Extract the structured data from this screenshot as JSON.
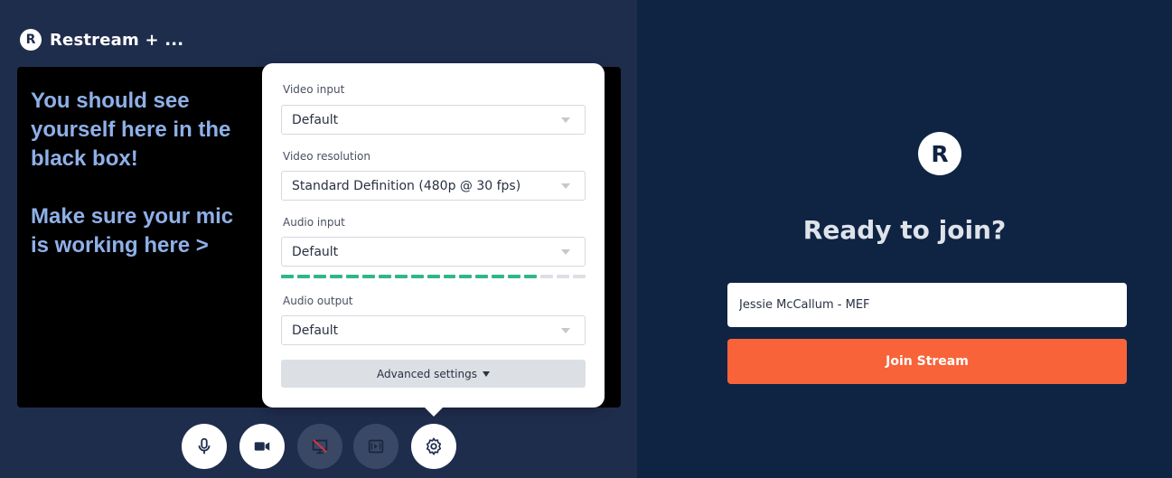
{
  "app": {
    "logo_letter": "R",
    "title": "Restream + ..."
  },
  "video_overlay": {
    "line1": "You should see yourself here in the black box!",
    "line2": "Make sure your mic is working here >"
  },
  "settings": {
    "video_input_label": "Video input",
    "video_input_value": "Default",
    "video_resolution_label": "Video resolution",
    "video_resolution_value": "Standard Definition (480p @ 30 fps)",
    "audio_input_label": "Audio input",
    "audio_input_value": "Default",
    "audio_level": {
      "active_segments": 16,
      "total_segments": 19,
      "active_color": "#2fb886",
      "inactive_color": "#dcdfe4"
    },
    "audio_output_label": "Audio output",
    "audio_output_value": "Default",
    "advanced_label": "Advanced settings"
  },
  "toolbar": {
    "buttons": [
      {
        "icon": "microphone-icon",
        "state": "on"
      },
      {
        "icon": "camera-icon",
        "state": "on"
      },
      {
        "icon": "screen-share-off-icon",
        "state": "off"
      },
      {
        "icon": "media-icon",
        "state": "off"
      },
      {
        "icon": "gear-icon",
        "state": "on"
      }
    ]
  },
  "join": {
    "logo_letter": "R",
    "heading": "Ready to join?",
    "name_value": "Jessie McCallum - MEF",
    "join_label": "Join Stream"
  },
  "colors": {
    "left_bg": "#1f2d4d",
    "right_bg": "#0f2443",
    "accent": "#f96339",
    "overlay_text": "#8fb0e8"
  }
}
